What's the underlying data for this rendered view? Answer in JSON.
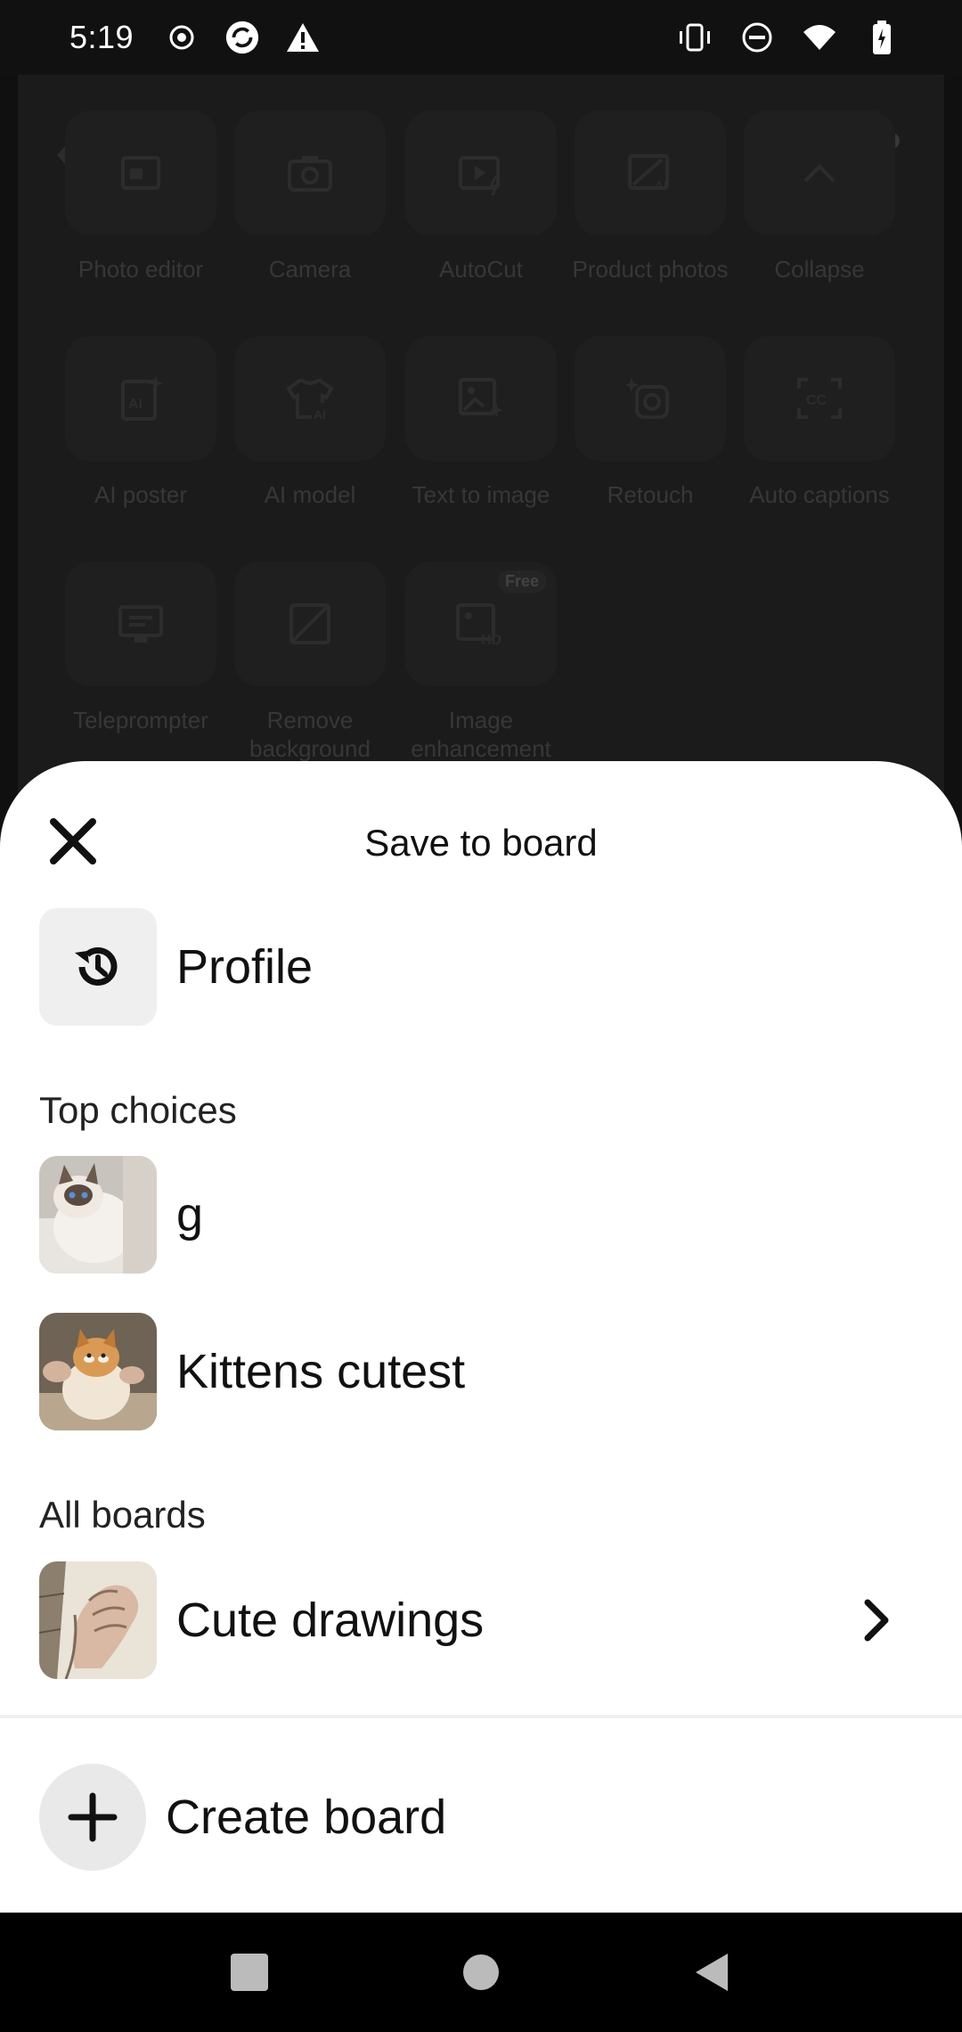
{
  "status_bar": {
    "time": "5:19",
    "left_icons": [
      "record-icon",
      "sync-icon",
      "warning-icon"
    ],
    "right_icons": [
      "vibrate-icon",
      "do-not-disturb-icon",
      "wifi-icon",
      "battery-icon"
    ]
  },
  "background_app": {
    "tools": [
      {
        "label": "Photo editor",
        "icon": "photo-editor-icon"
      },
      {
        "label": "Camera",
        "icon": "camera-icon"
      },
      {
        "label": "AutoCut",
        "icon": "autocut-icon"
      },
      {
        "label": "Product photos",
        "icon": "product-photos-icon"
      },
      {
        "label": "Collapse",
        "icon": "collapse-icon"
      },
      {
        "label": "AI poster",
        "icon": "ai-poster-icon"
      },
      {
        "label": "AI model",
        "icon": "ai-model-icon"
      },
      {
        "label": "Text to image",
        "icon": "text-to-image-icon"
      },
      {
        "label": "Retouch",
        "icon": "retouch-icon"
      },
      {
        "label": "Auto captions",
        "icon": "auto-captions-icon"
      },
      {
        "label": "Teleprompter",
        "icon": "teleprompter-icon"
      },
      {
        "label": "Remove background",
        "icon": "remove-background-icon"
      },
      {
        "label": "Image enhancement",
        "icon": "image-enhancement-icon",
        "badge": "Free"
      }
    ]
  },
  "sheet": {
    "title": "Save to board",
    "profile_label": "Profile",
    "top_choices_label": "Top choices",
    "top_choices": [
      {
        "name": "g"
      },
      {
        "name": "Kittens cutest"
      }
    ],
    "all_boards_label": "All boards",
    "all_boards": [
      {
        "name": "Cute drawings"
      }
    ],
    "create_board_label": "Create board"
  }
}
